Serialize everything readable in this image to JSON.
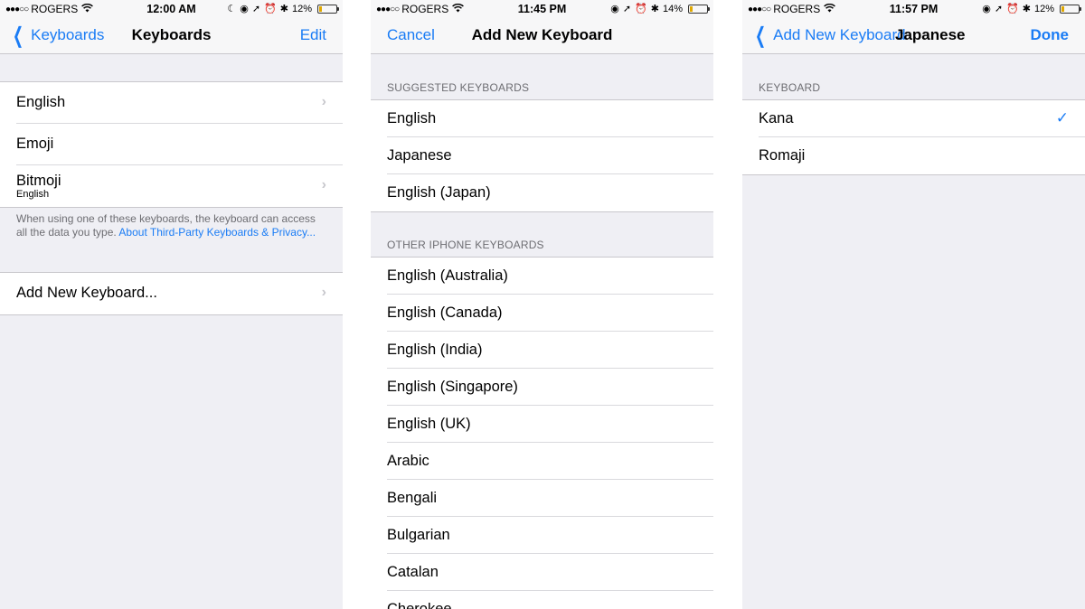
{
  "panel1": {
    "status": {
      "carrier": "ROGERS",
      "time": "12:00 AM",
      "battery": "12%"
    },
    "nav": {
      "back": "Keyboards",
      "title": "Keyboards",
      "right": "Edit"
    },
    "keyboards": [
      {
        "label": "English"
      },
      {
        "label": "Emoji"
      },
      {
        "label": "Bitmoji",
        "sub": "English"
      }
    ],
    "note_text": "When using one of these keyboards, the keyboard can access all the data you type. ",
    "note_link": "About Third-Party Keyboards & Privacy...",
    "add_label": "Add New Keyboard..."
  },
  "panel2": {
    "status": {
      "carrier": "ROGERS",
      "time": "11:45 PM",
      "battery": "14%"
    },
    "nav": {
      "left": "Cancel",
      "title": "Add New Keyboard"
    },
    "suggested_header": "SUGGESTED KEYBOARDS",
    "suggested": [
      "English",
      "Japanese",
      "English (Japan)"
    ],
    "other_header": "OTHER IPHONE KEYBOARDS",
    "other": [
      "English (Australia)",
      "English (Canada)",
      "English (India)",
      "English (Singapore)",
      "English (UK)",
      "Arabic",
      "Bengali",
      "Bulgarian",
      "Catalan",
      "Cherokee"
    ]
  },
  "panel3": {
    "status": {
      "carrier": "ROGERS",
      "time": "11:57 PM",
      "battery": "12%"
    },
    "nav": {
      "back": "Add New Keyboard",
      "title": "Japanese",
      "right": "Done"
    },
    "header": "KEYBOARD",
    "options": [
      "Kana",
      "Romaji"
    ],
    "selected": "Kana"
  },
  "colors": {
    "accent": "#1a7cf5",
    "background": "#efeff4",
    "battery_low": "#e0a800"
  }
}
